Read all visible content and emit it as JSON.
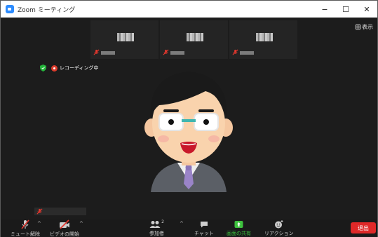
{
  "window": {
    "title": "Zoom ミーティング",
    "minimize_glyph": "−",
    "maximize_glyph": "☐",
    "close_glyph": "✕"
  },
  "view_button": {
    "label": "表示",
    "icon": "grid-view-icon"
  },
  "recording": {
    "label": "レコーディング中"
  },
  "toolbar": {
    "mute_label": "ミュート解除",
    "video_label": "ビデオの開始",
    "participants_label": "参加者",
    "participants_count": "2",
    "chat_label": "チャット",
    "share_label": "画面の共有",
    "reactions_label": "リアクション",
    "end_label": "退出"
  },
  "colors": {
    "accent_blue": "#2d8cff",
    "share_green": "#3ec13e",
    "end_red": "#e02828",
    "mute_red": "#e5372e"
  }
}
